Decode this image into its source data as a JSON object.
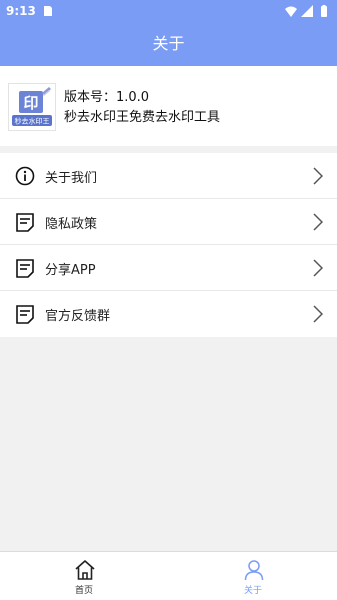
{
  "status_bar": {
    "time": "9:13"
  },
  "header": {
    "title": "关于"
  },
  "app_info": {
    "logo_glyph": "印",
    "logo_caption": "秒去水印王",
    "version_text": "版本号：1.0.0",
    "app_name": "秒去水印王免费去水印工具"
  },
  "menu": {
    "items": [
      {
        "label": "关于我们",
        "icon": "info-icon"
      },
      {
        "label": "隐私政策",
        "icon": "document-icon"
      },
      {
        "label": "分享APP",
        "icon": "document-icon"
      },
      {
        "label": "官方反馈群",
        "icon": "document-icon"
      }
    ]
  },
  "bottom_nav": {
    "items": [
      {
        "label": "首页",
        "icon": "home-icon"
      },
      {
        "label": "关于",
        "icon": "person-icon",
        "active": true
      }
    ]
  },
  "colors": {
    "accent": "#7b9cf5",
    "background": "#f1f1f1"
  }
}
